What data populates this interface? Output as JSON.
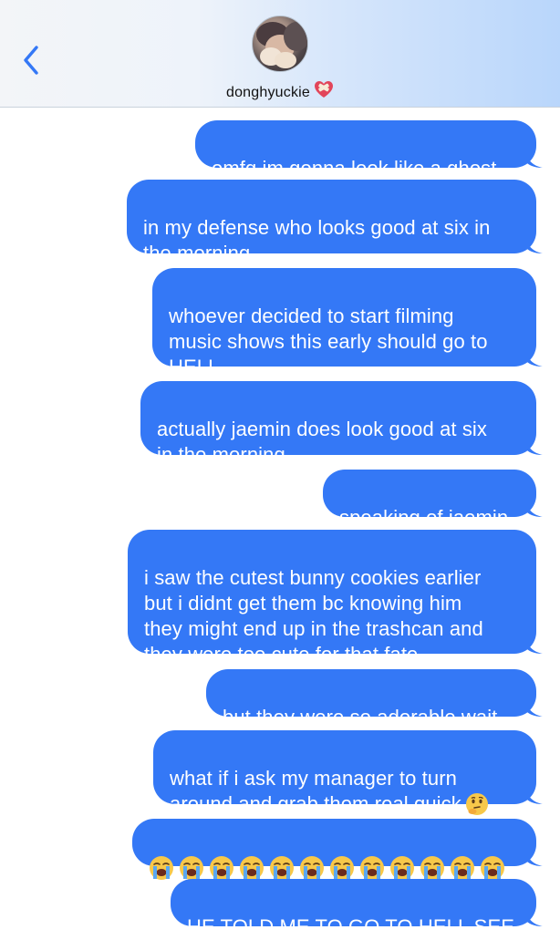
{
  "header": {
    "contact_name": "donghyuckie",
    "back_icon": "chevron-left-icon",
    "heart_icon": "mending-heart-icon",
    "accent_color": "#3478f6"
  },
  "messages": [
    {
      "text": "omfg im gonna look like a ghost"
    },
    {
      "text": "in my defense who looks good at six in\nthe morning"
    },
    {
      "text": "whoever decided to start filming\nmusic shows this early should go to\nHELL"
    },
    {
      "text": "actually jaemin does look good at six\nin the morning..."
    },
    {
      "text": "speaking of jaemin"
    },
    {
      "text": "i saw the cutest bunny cookies earlier\nbut i didnt get them bc knowing him\nthey might end up in the trashcan and\nthey were too cute for that fate..."
    },
    {
      "text": "but they were so adorable wait"
    },
    {
      "text": "what if i ask my manager to turn\naround and grab them real quick",
      "trailing_emoji": "thinking-face-icon"
    },
    {
      "emoji": "loudly-crying-face-icon",
      "emoji_count": 12
    },
    {
      "text": "HE TOLD ME TO GO TO HELL SEE"
    }
  ],
  "colors": {
    "bubble": "#3478f6",
    "bubble_text": "#ffffff"
  }
}
